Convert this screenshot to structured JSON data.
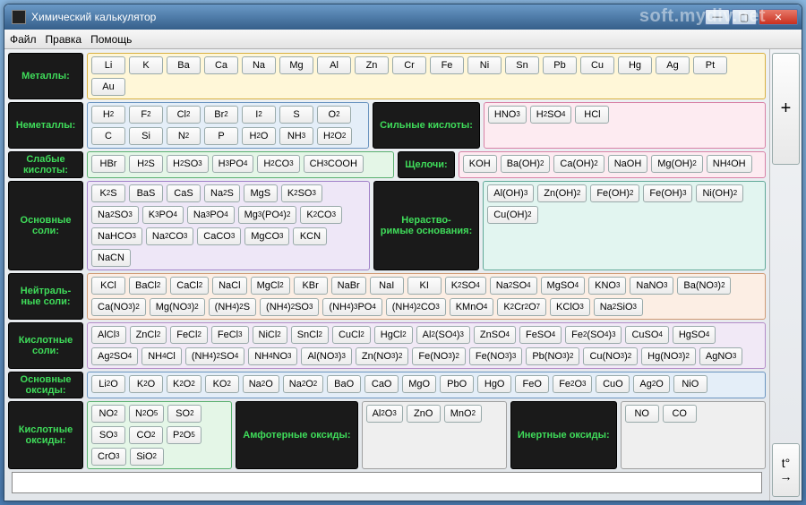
{
  "window": {
    "title": "Химический калькулятор",
    "watermark": "soft.mydiv.net"
  },
  "menu": {
    "file": "Файл",
    "edit": "Правка",
    "help": "Помощь"
  },
  "sysbtns": {
    "min": "—",
    "max": "▢",
    "close": "✕"
  },
  "side": {
    "plus": "+",
    "temp": "t°\n→"
  },
  "labels": {
    "metals": "Металлы:",
    "nonmetals": "Неметаллы:",
    "strong_acids": "Сильные кислоты:",
    "weak_acids": "Слабые кислоты:",
    "alkalis": "Щелочи:",
    "basic_salts": "Основные соли:",
    "insoluble_bases": "Нераство-римые основания:",
    "neutral_salts": "Нейтраль-ные соли:",
    "acid_salts": "Кислотные соли:",
    "basic_oxides": "Основные оксиды:",
    "acid_oxides": "Кислотные оксиды:",
    "amphoteric_oxides": "Амфотерные оксиды:",
    "inert_oxides": "Инертные оксиды:"
  },
  "metals": [
    "Li",
    "K",
    "Ba",
    "Ca",
    "Na",
    "Mg",
    "Al",
    "Zn",
    "Cr",
    "Fe",
    "Ni",
    "Sn",
    "Pb",
    "Cu",
    "Hg",
    "Ag",
    "Pt",
    "Au"
  ],
  "nonmetals": [
    "H₂",
    "F₂",
    "Cl₂",
    "Br₂",
    "I₂",
    "S",
    "O₂",
    "C",
    "Si",
    "N₂",
    "P",
    "H₂O",
    "NH₃",
    "H₂O₂"
  ],
  "strong_acids": [
    "HNO₃",
    "H₂SO₄",
    "HCl"
  ],
  "weak_acids": [
    "HBr",
    "H₂S",
    "H₂SO₃",
    "H₃PO₄",
    "H₂CO₃",
    "CH₃COOH"
  ],
  "alkalis": [
    "KOH",
    "Ba(OH)₂",
    "Ca(OH)₂",
    "NaOH",
    "Mg(OH)₂",
    "NH₄OH"
  ],
  "basic_salts": [
    "K₂S",
    "BaS",
    "CaS",
    "Na₂S",
    "MgS",
    "K₂SO₃",
    "Na₂SO₃",
    "K₃PO₄",
    "Na₃PO₄",
    "Mg₃(PO₄)₂",
    "K₂CO₃",
    "NaHCO₃",
    "Na₂CO₃",
    "CaCO₃",
    "MgCO₃",
    "KCN",
    "NaCN"
  ],
  "insoluble_bases": [
    "Al(OH)₃",
    "Zn(OH)₂",
    "Fe(OH)₂",
    "Fe(OH)₃",
    "Ni(OH)₂",
    "Cu(OH)₂"
  ],
  "neutral_salts": [
    "KCl",
    "BaCl₂",
    "CaCl₂",
    "NaCl",
    "MgCl₂",
    "KBr",
    "NaBr",
    "NaI",
    "KI",
    "K₂SO₄",
    "Na₂SO₄",
    "MgSO₄",
    "KNO₃",
    "NaNO₃",
    "Ba(NO₃)₂",
    "Ca(NO₃)₂",
    "Mg(NO₃)₂",
    "(NH₄)₂S",
    "(NH₄)₂SO₃",
    "(NH₄)₃PO₄",
    "(NH₄)₂CO₃",
    "KMnO₄",
    "K₂Cr₂O₇",
    "KClO₃",
    "Na₂SiO₃"
  ],
  "acid_salts": [
    "AlCl₃",
    "ZnCl₂",
    "FeCl₂",
    "FeCl₃",
    "NiCl₂",
    "SnCl₂",
    "CuCl₂",
    "HgCl₂",
    "Al₂(SO₄)₃",
    "ZnSO₄",
    "FeSO₄",
    "Fe₂(SO₄)₃",
    "CuSO₄",
    "HgSO₄",
    "Ag₂SO₄",
    "NH₄Cl",
    "(NH₄)₂SO₄",
    "NH₄NO₃",
    "Al(NO₃)₃",
    "Zn(NO₃)₂",
    "Fe(NO₃)₂",
    "Fe(NO₃)₃",
    "Pb(NO₃)₂",
    "Cu(NO₃)₂",
    "Hg(NO₃)₂",
    "AgNO₃"
  ],
  "basic_oxides": [
    "Li₂O",
    "K₂O",
    "K₂O₂",
    "KO₂",
    "Na₂O",
    "Na₂O₂",
    "BaO",
    "CaO",
    "MgO",
    "PbO",
    "HgO",
    "FeO",
    "Fe₂O₃",
    "CuO",
    "Ag₂O",
    "NiO"
  ],
  "acid_oxides": [
    "NO₂",
    "N₂O₅",
    "SO₂",
    "SO₃",
    "CO₂",
    "P₂O₅",
    "CrO₃",
    "SiO₂"
  ],
  "amphoteric_oxides": [
    "Al₂O₃",
    "ZnO",
    "MnO₂"
  ],
  "inert_oxides": [
    "NO",
    "CO"
  ]
}
